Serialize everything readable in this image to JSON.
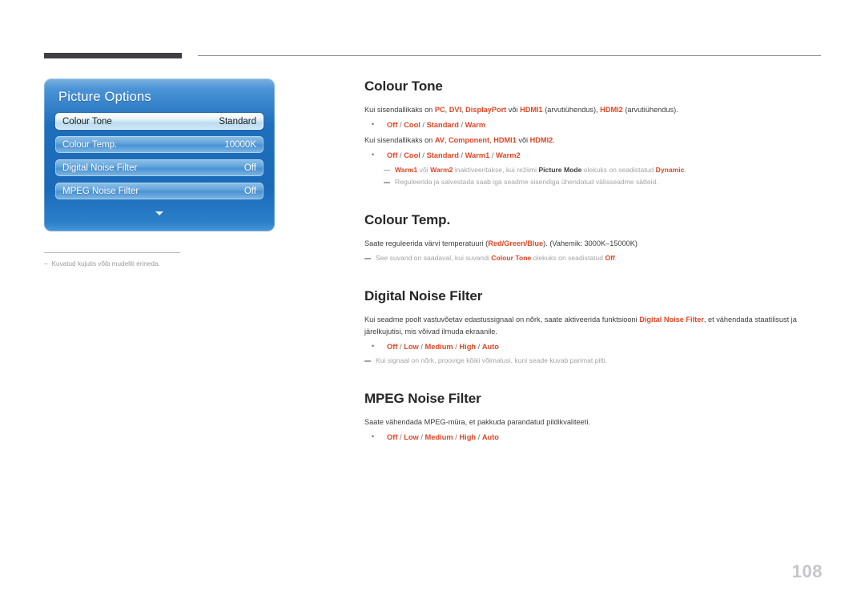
{
  "page": {
    "number": "108"
  },
  "osd": {
    "title": "Picture Options",
    "scroll_down_icon": "chevron-down-icon",
    "items": [
      {
        "label": "Colour Tone",
        "value": "Standard",
        "selected": true
      },
      {
        "label": "Colour Temp.",
        "value": "10000K",
        "selected": false
      },
      {
        "label": "Digital Noise Filter",
        "value": "Off",
        "selected": false
      },
      {
        "label": "MPEG Noise Filter",
        "value": "Off",
        "selected": false
      }
    ]
  },
  "left_note": {
    "dash": "–",
    "text": "Kuvatud kujutis võib mudeliti erineda."
  },
  "sections": {
    "colour_tone": {
      "heading": "Colour Tone",
      "para1": {
        "lead": "Kui sisendallikaks on ",
        "k1": "PC",
        "sep1": ", ",
        "k2": "DVI",
        "sep2": ", ",
        "k3": "DisplayPort",
        "sep3": " või ",
        "k4": "HDMI1",
        "sep4": " (arvutiühendus), ",
        "k5": "HDMI2",
        "tail": " (arvutiühendus)."
      },
      "bullet1": {
        "o1": "Off",
        "o2": "Cool",
        "o3": "Standard",
        "o4": "Warm"
      },
      "para2": {
        "lead": "Kui sisendallikaks on ",
        "k1": "AV",
        "sep1": ", ",
        "k2": "Component",
        "sep2": ", ",
        "k3": "HDMI1",
        "sep3": " või ",
        "k4": "HDMI2",
        "tail": "."
      },
      "bullet2": {
        "o1": "Off",
        "o2": "Cool",
        "o3": "Standard",
        "o4": "Warm1",
        "o5": "Warm2"
      },
      "note1": {
        "k1": "Warm1",
        "t1": " või ",
        "k2": "Warm2",
        "t2": " inaktiveeritakse, kui režiimi ",
        "k3": "Picture Mode",
        "t3": " olekuks on seadistatud ",
        "k4": "Dynamic",
        "t4": "."
      },
      "note2": "Reguleerida ja salvestada saab iga seadme sisendiga ühendatud välisseadme sätteid."
    },
    "colour_temp": {
      "heading": "Colour Temp.",
      "para1": {
        "lead": "Saate reguleerida värvi temperatuuri (",
        "k1": "Red/Green/Blue",
        "tail": "). (Vahemik: 3000K–15000K)"
      },
      "note1": {
        "t1": "See suvand on saadaval, kui suvandi ",
        "k1": "Colour Tone",
        "t2": " olekuks on seadistatud ",
        "k2": "Off",
        "t3": "."
      }
    },
    "digital_noise_filter": {
      "heading": "Digital Noise Filter",
      "para1": {
        "lead": "Kui seadme poolt vastuvõetav edastussignaal on nõrk, saate aktiveerida funktsiooni ",
        "k1": "Digital Noise Filter",
        "tail": ", et vähendada staatilisust ja järelkujutisi, mis võivad ilmuda ekraanile."
      },
      "bullet1": {
        "o1": "Off",
        "o2": "Low",
        "o3": "Medium",
        "o4": "High",
        "o5": "Auto"
      },
      "note1": "Kui signaal on nõrk, proovige kõiki võimalusi, kuni seade kuvab parimat pilti."
    },
    "mpeg_noise_filter": {
      "heading": "MPEG Noise Filter",
      "para1": "Saate vähendada MPEG-müra, et pakkuda parandatud pildikvaliteeti.",
      "bullet1": {
        "o1": "Off",
        "o2": "Low",
        "o3": "Medium",
        "o4": "High",
        "o5": "Auto"
      }
    }
  },
  "colors": {
    "accent_red": "#de4726",
    "heading_dark": "#262626",
    "note_gray": "#a4a4a8",
    "panel_blue": "#1f6fbd",
    "page_number_gray": "#c5c5ca"
  }
}
